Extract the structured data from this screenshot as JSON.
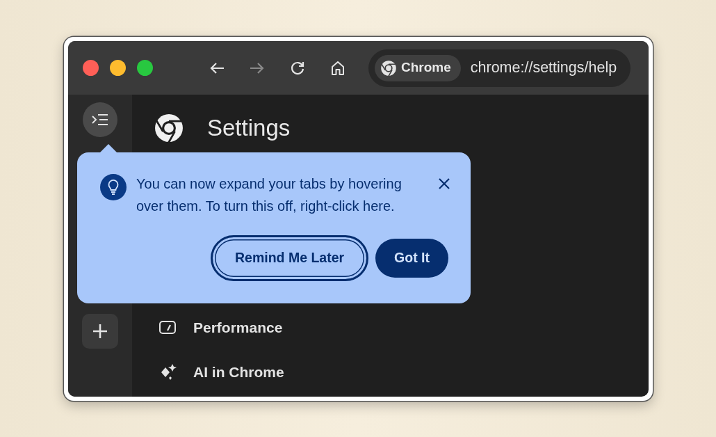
{
  "window": {
    "traffic_lights": [
      {
        "color": "#ff5f57"
      },
      {
        "color": "#febc2e"
      },
      {
        "color": "#28c840"
      }
    ]
  },
  "toolbar": {
    "buttons": [
      {
        "kind": "back",
        "disabled": false
      },
      {
        "kind": "forward",
        "disabled": true
      },
      {
        "kind": "reload",
        "disabled": false
      },
      {
        "kind": "home",
        "disabled": false
      }
    ]
  },
  "omnibox": {
    "chip": "Chrome",
    "url": "chrome://settings/help"
  },
  "sidebar": {
    "buttons": [
      {
        "kind": "toggle"
      },
      {
        "kind": "new-tab"
      }
    ]
  },
  "page": {
    "title": "Settings",
    "menu": [
      {
        "kind": "performance",
        "label": "Performance"
      },
      {
        "kind": "ai",
        "label": "AI in Chrome"
      }
    ]
  },
  "popover": {
    "text": "You can now expand your tabs by hovering over them. To turn this off, right-click here.",
    "buttons": [
      {
        "kind": "secondary",
        "label": "Remind Me Later",
        "focused": true
      },
      {
        "kind": "primary",
        "label": "Got It",
        "focused": false
      }
    ]
  }
}
